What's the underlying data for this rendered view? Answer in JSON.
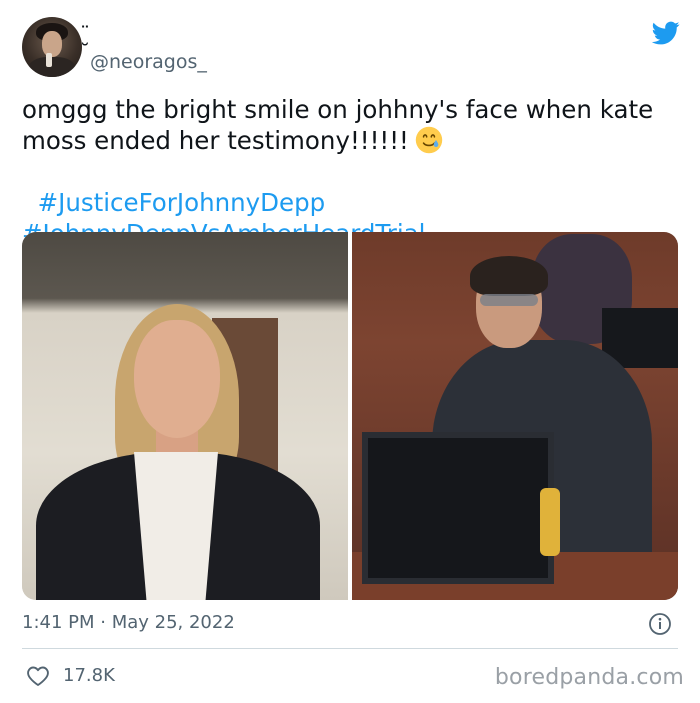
{
  "header": {
    "display_name": "̮̈",
    "handle": "@neoragos_"
  },
  "tweet": {
    "text_line": "omggg the bright smile on johhny's face when kate moss ended her testimony!!!!!!",
    "emoji_name": "smiling-face-with-tear",
    "hashtags": [
      "#JusticeForJohnnyDepp",
      "#JohnnyDeppVsAmberHeardTrial"
    ]
  },
  "meta": {
    "timestamp": "1:41 PM · May 25, 2022",
    "likes": "17.8K"
  },
  "watermark": "boredpanda.com",
  "colors": {
    "accent": "#1d9bf0",
    "secondary_text": "#536471",
    "primary_text": "#0f1419"
  },
  "icons": {
    "brand": "twitter-bird-icon",
    "info": "info-icon",
    "like": "heart-icon"
  }
}
